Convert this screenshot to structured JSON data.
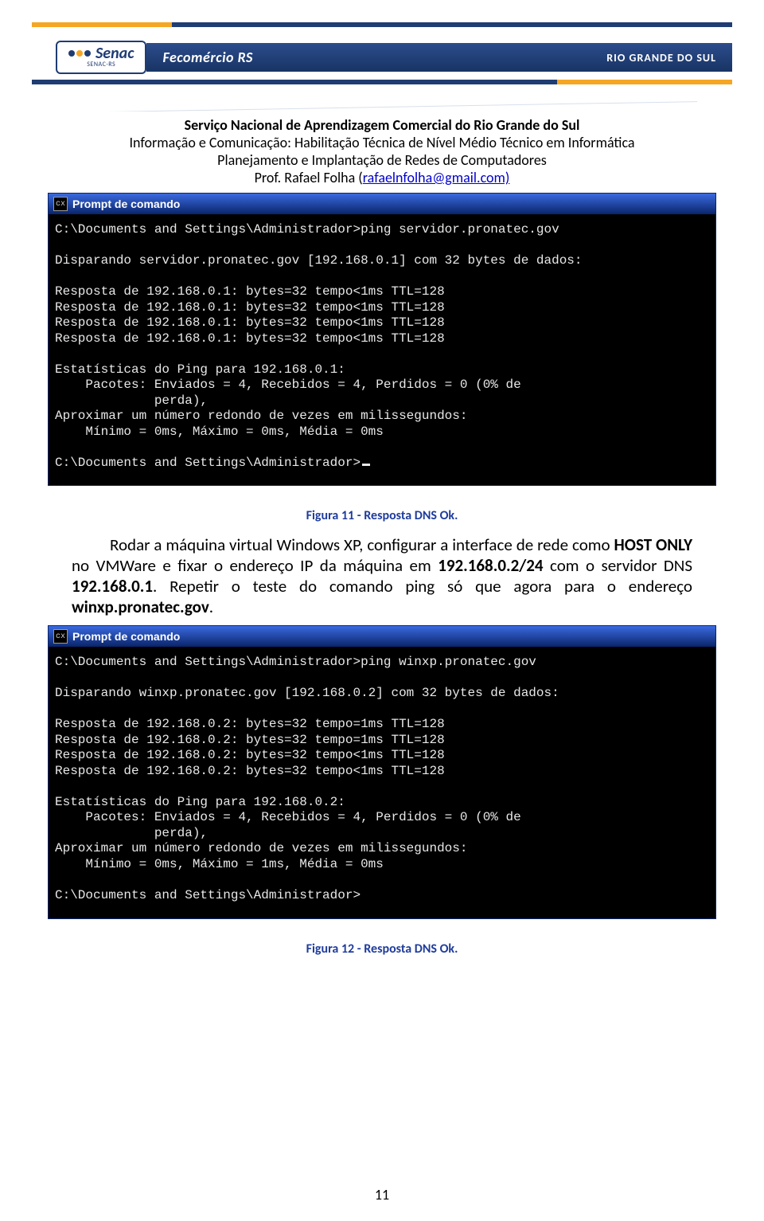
{
  "banner": {
    "senac_label": "Senac",
    "senac_sub": "SENAC-RS",
    "fecom": "Fecomércio RS",
    "rgs": "RIO GRANDE DO SUL"
  },
  "header": {
    "line1": "Serviço Nacional de Aprendizagem Comercial do Rio Grande do Sul",
    "line2": "Informação e Comunicação: Habilitação Técnica de Nível Médio Técnico em Informática",
    "line3": "Planejamento e Implantação de Redes de Computadores",
    "line4_prefix": "Prof. Rafael Folha (",
    "line4_link": "rafaelnfolha@gmail.com)"
  },
  "cmd1": {
    "title_prefix": "cx",
    "title": "Prompt de comando",
    "l1": "C:\\Documents and Settings\\Administrador>ping servidor.pronatec.gov",
    "l2": "",
    "l3": "Disparando servidor.pronatec.gov [192.168.0.1] com 32 bytes de dados:",
    "l4": "",
    "l5": "Resposta de 192.168.0.1: bytes=32 tempo<1ms TTL=128",
    "l6": "Resposta de 192.168.0.1: bytes=32 tempo<1ms TTL=128",
    "l7": "Resposta de 192.168.0.1: bytes=32 tempo<1ms TTL=128",
    "l8": "Resposta de 192.168.0.1: bytes=32 tempo<1ms TTL=128",
    "l9": "",
    "l10": "Estatísticas do Ping para 192.168.0.1:",
    "l11": "    Pacotes: Enviados = 4, Recebidos = 4, Perdidos = 0 (0% de",
    "l12": "             perda),",
    "l13": "Aproximar um número redondo de vezes em milissegundos:",
    "l14": "    Mínimo = 0ms, Máximo = 0ms, Média = 0ms",
    "l15": "",
    "l16": "C:\\Documents and Settings\\Administrador>"
  },
  "caption1": "Figura 11 - Resposta DNS Ok.",
  "para": {
    "t1": "Rodar a máquina virtual Windows XP, configurar a interface de rede como ",
    "b1": "HOST ONLY",
    "t2": " no VMWare e fixar o endereço IP da máquina em ",
    "b2": "192.168.0.2/24",
    "t3": " com o servidor DNS ",
    "b3": "192.168.0.1",
    "t4": ". Repetir o teste do comando ping só que agora para o endereço ",
    "b4": "winxp.pronatec.gov",
    "t5": "."
  },
  "cmd2": {
    "title_prefix": "cx",
    "title": "Prompt de comando",
    "l1": "C:\\Documents and Settings\\Administrador>ping winxp.pronatec.gov",
    "l2": "",
    "l3": "Disparando winxp.pronatec.gov [192.168.0.2] com 32 bytes de dados:",
    "l4": "",
    "l5": "Resposta de 192.168.0.2: bytes=32 tempo=1ms TTL=128",
    "l6": "Resposta de 192.168.0.2: bytes=32 tempo=1ms TTL=128",
    "l7": "Resposta de 192.168.0.2: bytes=32 tempo<1ms TTL=128",
    "l8": "Resposta de 192.168.0.2: bytes=32 tempo<1ms TTL=128",
    "l9": "",
    "l10": "Estatísticas do Ping para 192.168.0.2:",
    "l11": "    Pacotes: Enviados = 4, Recebidos = 4, Perdidos = 0 (0% de",
    "l12": "             perda),",
    "l13": "Aproximar um número redondo de vezes em milissegundos:",
    "l14": "    Mínimo = 0ms, Máximo = 1ms, Média = 0ms",
    "l15": "",
    "l16": "C:\\Documents and Settings\\Administrador>"
  },
  "caption2": "Figura 12 - Resposta DNS Ok.",
  "page_number": "11"
}
